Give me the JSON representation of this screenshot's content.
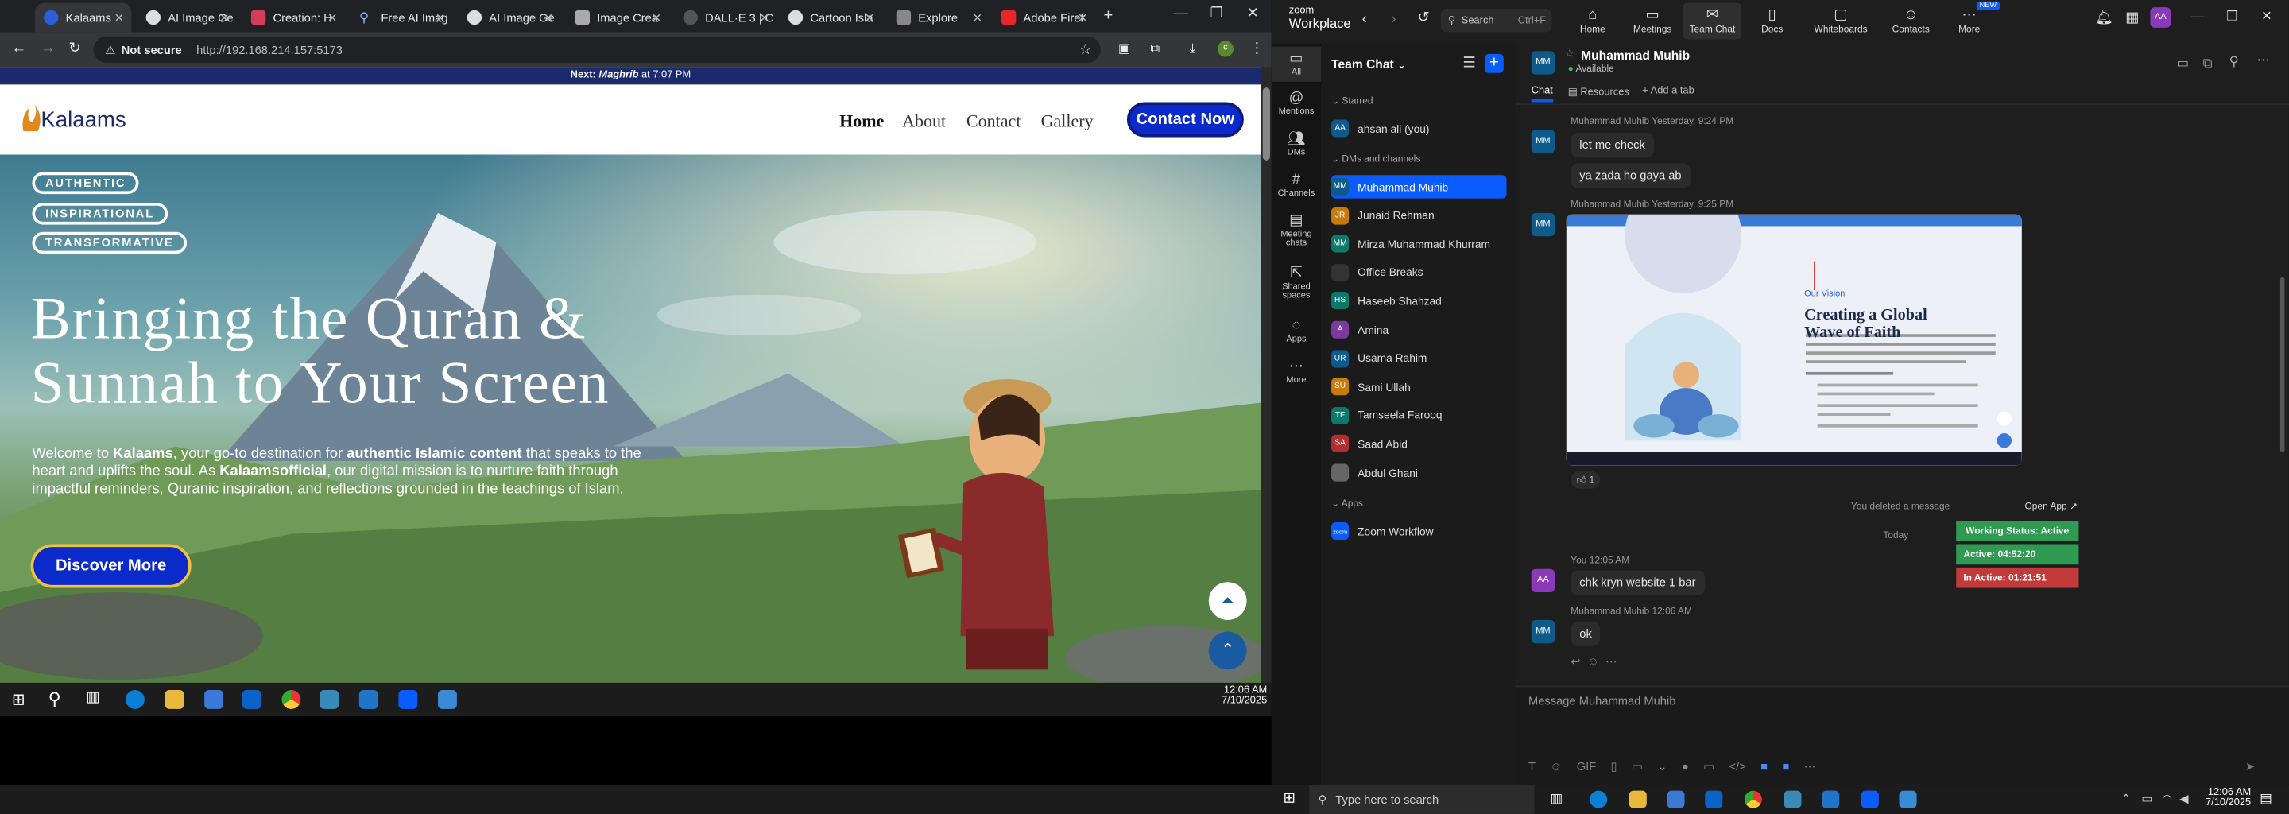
{
  "browser": {
    "tabs": [
      {
        "label": "Kalaams",
        "active": true,
        "icon": "kalaams-favicon"
      },
      {
        "label": "AI Image Ge",
        "icon": "openai-favicon"
      },
      {
        "label": "Creation: H",
        "icon": "creation-favicon"
      },
      {
        "label": "Free AI Imag",
        "icon": "search-favicon"
      },
      {
        "label": "AI Image Ge",
        "icon": "openai-favicon"
      },
      {
        "label": "Image Crea",
        "icon": "image-favicon"
      },
      {
        "label": "DALL·E 3 | C",
        "icon": "dalle-favicon"
      },
      {
        "label": "Cartoon Isla",
        "icon": "openai-favicon"
      },
      {
        "label": "Explore",
        "icon": "explore-favicon"
      },
      {
        "label": "Adobe Firef",
        "icon": "adobe-favicon"
      }
    ],
    "security_label": "Not secure",
    "url": "http://192.168.214.157:5173"
  },
  "site": {
    "notice_prefix": "Next:",
    "notice_prayer": "Maghrib",
    "notice_suffix": "at 7:07 PM",
    "logo_text": "Kalaams",
    "nav": [
      "Home",
      "About",
      "Contact",
      "Gallery"
    ],
    "cta": "Contact Now",
    "pills": [
      "AUTHENTIC",
      "INSPIRATIONAL",
      "TRANSFORMATIVE"
    ],
    "headline_line1": "Bringing the Quran &",
    "headline_line2": "Sunnah to Your Screen",
    "intro_p1a": "Welcome to ",
    "intro_p1b": "Kalaams",
    "intro_p1c": ", your go-to destination for ",
    "intro_p1d": "authentic Islamic content",
    "intro_p1e": " that speaks to the",
    "intro_line2a": "heart and uplifts the soul. As ",
    "intro_line2b": "Kalaamsofficial",
    "intro_line2c": ", our digital mission is to nurture faith through",
    "intro_line3": "impactful reminders, Quranic inspiration, and reflections grounded in the teachings of Islam.",
    "discover": "Discover More"
  },
  "left_clock": {
    "time": "12:06 AM",
    "date": "7/10/2025"
  },
  "zoom": {
    "brand_top": "zoom",
    "brand_bottom": "Workplace",
    "search": "Search",
    "search_shortcut": "Ctrl+F",
    "topnav": [
      "Home",
      "Meetings",
      "Team Chat",
      "Docs",
      "Whiteboards",
      "Contacts",
      "More"
    ],
    "new_badge": "NEW",
    "user_initials": "AA",
    "rail": [
      "All",
      "Mentions",
      "DMs",
      "Channels",
      "Meeting chats",
      "Shared spaces",
      "Apps",
      "More"
    ],
    "panel_title": "Team Chat",
    "starred_label": "Starred",
    "dm_label": "DMs and channels",
    "apps_label": "Apps",
    "starred": [
      {
        "name": "ahsan ali (you)",
        "initials": "AA",
        "color": "#0e5a8a"
      }
    ],
    "contacts": [
      {
        "name": "Muhammad Muhib",
        "initials": "MM",
        "color": "#0e5a8a",
        "selected": true
      },
      {
        "name": "Junaid Rehman",
        "initials": "JR",
        "color": "#c77b0b"
      },
      {
        "name": "Mirza Muhammad Khurram",
        "initials": "MM",
        "color": "#0b7a6a"
      },
      {
        "name": "Office Breaks",
        "initials": "",
        "color": "#333333"
      },
      {
        "name": "Haseeb Shahzad",
        "initials": "HS",
        "color": "#0b7a6a"
      },
      {
        "name": "Amina",
        "initials": "A",
        "color": "#7a3aa0"
      },
      {
        "name": "Usama Rahim",
        "initials": "UR",
        "color": "#0e5a8a"
      },
      {
        "name": "Sami Ullah",
        "initials": "SU",
        "color": "#c77b0b"
      },
      {
        "name": "Tamseela Farooq",
        "initials": "TF",
        "color": "#0b7a6a"
      },
      {
        "name": "Saad Abid",
        "initials": "SA",
        "color": "#b03030"
      },
      {
        "name": "Abdul Ghani",
        "initials": "",
        "color": "#666666"
      }
    ],
    "apps": [
      {
        "name": "Zoom Workflow",
        "initials": "zoom",
        "color": "#0b5cff"
      }
    ],
    "chat": {
      "name": "Muhammad Muhib",
      "status": "Available",
      "tabs": [
        "Chat",
        "Resources",
        "Add a tab"
      ],
      "msg1_meta_name": "Muhammad Muhib",
      "msg1_meta_time": "Yesterday, 9:24 PM",
      "msg1_a": "let me check",
      "msg1_b": "ya zada ho gaya ab",
      "msg2_meta_name": "Muhammad Muhib",
      "msg2_meta_time": "Yesterday, 9:25 PM",
      "shot_heading_small": "Our Vision",
      "shot_heading1": "Creating a Global",
      "shot_heading2": "Wave of Faith",
      "reaction_count": "1",
      "deleted_note": "You deleted a message",
      "open_app": "Open App",
      "today": "Today",
      "status_working": "Working Status: Active",
      "status_active": "Active: 04:52:20",
      "status_inactive": "In Active: 01:21:51",
      "msg3_meta_name": "You",
      "msg3_meta_time": "12:05 AM",
      "msg3": "chk kryn website 1 bar",
      "msg4_meta_name": "Muhammad Muhib",
      "msg4_meta_time": "12:06 AM",
      "msg4": "ok",
      "compose_placeholder": "Message Muhammad Muhib"
    }
  },
  "windows": {
    "search_placeholder": "Type here to search",
    "time": "12:06 AM",
    "date": "7/10/2025"
  }
}
